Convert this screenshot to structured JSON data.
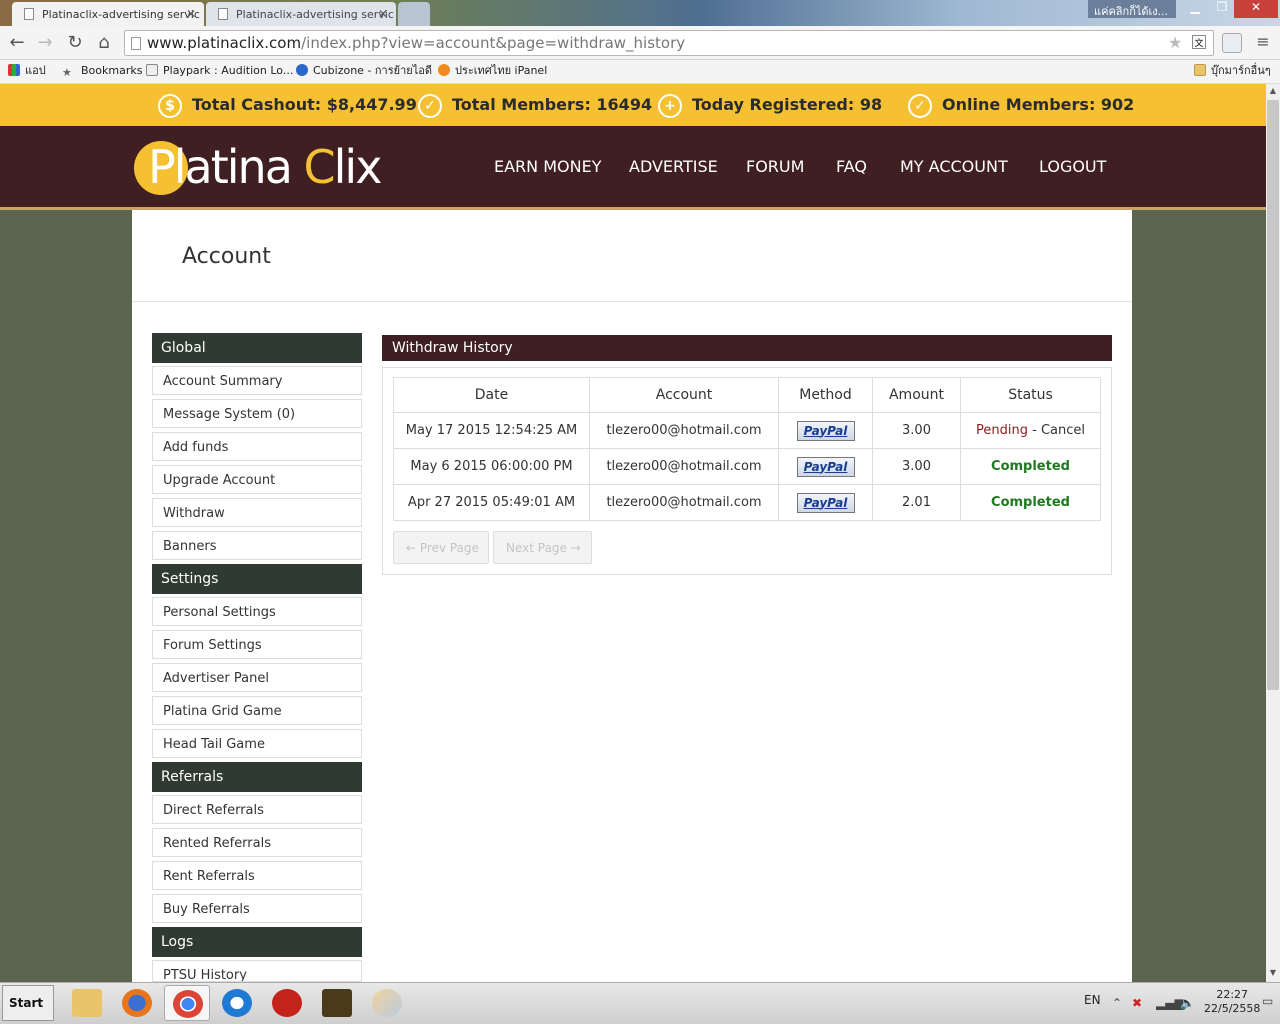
{
  "browser": {
    "tabs": [
      {
        "title": "Platinaclix-advertising servic"
      },
      {
        "title": "Platinaclix-advertising servic"
      }
    ],
    "user_tag": "แค่คลิกก็ได้เง...",
    "url_host": "www.platinaclix.com",
    "url_path": "/index.php?view=account&page=withdraw_history",
    "bookmarks": [
      {
        "label": "แอป"
      },
      {
        "label": "Bookmarks"
      },
      {
        "label": "Playpark : Audition Lo..."
      },
      {
        "label": "Cubizone - การย้ายไอดี"
      },
      {
        "label": "ประเทศไทย iPanel"
      }
    ],
    "other_bookmarks": "บุ๊กมาร์กอื่นๆ"
  },
  "stats": {
    "cashout": "Total Cashout: $8,447.99",
    "members": "Total Members: 16494",
    "registered": "Today Registered: 98",
    "online": "Online Members: 902"
  },
  "header": {
    "logo_p": "Pl",
    "logo_rest": "atina ",
    "logo_c": "C",
    "logo_lix": "lix",
    "nav": [
      "EARN MONEY",
      "ADVERTISE",
      "FORUM",
      "FAQ",
      "MY ACCOUNT",
      "LOGOUT"
    ]
  },
  "page": {
    "title": "Account"
  },
  "sidebar": {
    "sections": [
      {
        "title": "Global",
        "items": [
          "Account Summary",
          "Message System (0)",
          "Add funds",
          "Upgrade Account",
          "Withdraw",
          "Banners"
        ]
      },
      {
        "title": "Settings",
        "items": [
          "Personal Settings",
          "Forum Settings",
          "Advertiser Panel",
          "Platina Grid Game",
          "Head Tail Game"
        ]
      },
      {
        "title": "Referrals",
        "items": [
          "Direct Referrals",
          "Rented Referrals",
          "Rent Referrals",
          "Buy Referrals"
        ]
      },
      {
        "title": "Logs",
        "items": [
          "PTSU History"
        ]
      }
    ]
  },
  "withdraw": {
    "title": "Withdraw History",
    "columns": [
      "Date",
      "Account",
      "Method",
      "Amount",
      "Status"
    ],
    "rows": [
      {
        "date": "May 17 2015 12:54:25 AM",
        "account": "tlezero00@hotmail.com",
        "method": "PayPal",
        "amount": "3.00",
        "status": "Pending",
        "sep": " - ",
        "action": "Cancel"
      },
      {
        "date": "May 6 2015 06:00:00 PM",
        "account": "tlezero00@hotmail.com",
        "method": "PayPal",
        "amount": "3.00",
        "status": "Completed"
      },
      {
        "date": "Apr 27 2015 05:49:01 AM",
        "account": "tlezero00@hotmail.com",
        "method": "PayPal",
        "amount": "2.01",
        "status": "Completed"
      }
    ],
    "prev": "← Prev Page",
    "next": "Next Page →"
  },
  "taskbar": {
    "start": "Start",
    "lang": "EN",
    "time": "22:27",
    "date": "22/5/2558"
  },
  "colors": {
    "stats_bar": "#f5c133",
    "header": "#3f1f22",
    "sidebar_header": "#2f3a33",
    "pending": "#8a1e1e",
    "completed": "#1e7a1e"
  }
}
